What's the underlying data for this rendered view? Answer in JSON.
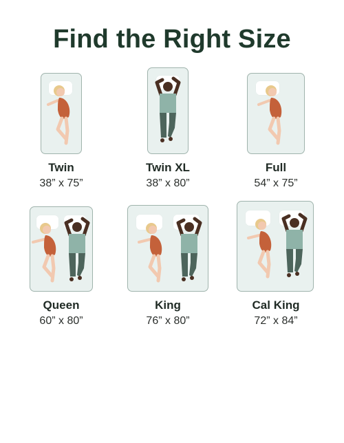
{
  "title": "Find the Right Size",
  "sizes": [
    {
      "name": "Twin",
      "dims": "38” x 75”"
    },
    {
      "name": "Twin XL",
      "dims": "38” x 80”"
    },
    {
      "name": "Full",
      "dims": "54” x 75”"
    },
    {
      "name": "Queen",
      "dims": "60” x 80”"
    },
    {
      "name": "King",
      "dims": "76” x 80”"
    },
    {
      "name": "Cal King",
      "dims": "72” x 84”"
    }
  ],
  "colors": {
    "title": "#1f3a2c",
    "mattress": "#e9f1ef",
    "mattress_border": "#9fb3ac",
    "woman_dress": "#c4613a",
    "woman_hair": "#e8c98c",
    "skin_light": "#f2c9b0",
    "man_shirt": "#8fb3a8",
    "man_pants": "#4d655c",
    "skin_dark": "#4a2f22"
  },
  "icons": [
    "sleeping-woman-icon",
    "sleeping-man-icon",
    "pillow-icon",
    "mattress-icon"
  ]
}
